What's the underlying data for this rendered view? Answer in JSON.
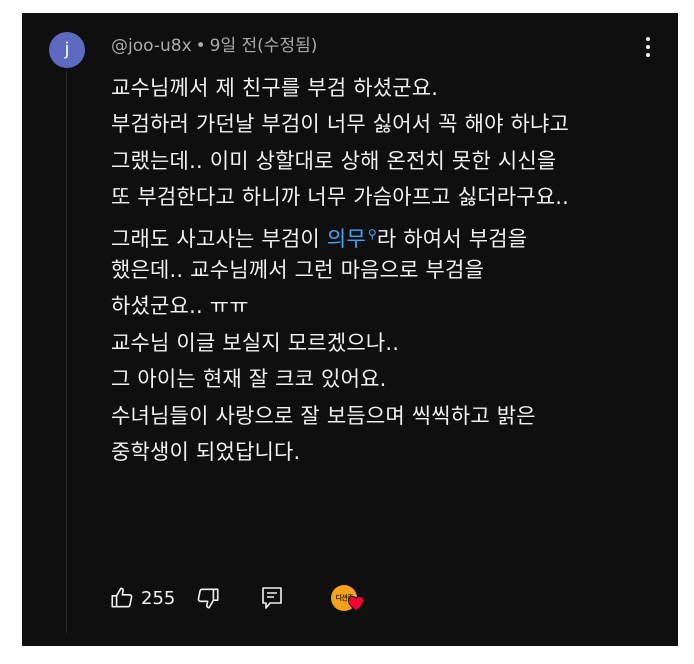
{
  "comment": {
    "avatar_letter": "j",
    "author": "@joo-u8x",
    "separator": "•",
    "timestamp": "9일 전(수정됨)",
    "lines": [
      {
        "text": "교수님께서 제 친구를 부검 하셨군요."
      },
      {
        "text": "부검하러 가던날 부검이 너무 싫어서 꼭 해야 하냐고"
      },
      {
        "text": "그랬는데.. 이미 상할대로 상해 온전치 못한 시신을"
      },
      {
        "text": "또 부검한다고 하니까 너무 가슴아프고 싫더라구요.."
      },
      {
        "pre": "그래도 사고사는 부검이 ",
        "hashtag": "의무",
        "post": "라 하여서 부검을"
      },
      {
        "text": "했은데.. 교수님께서 그런 마음으로 부검을"
      },
      {
        "text": "하셨군요.. ㅠㅠ"
      },
      {
        "text": "교수님 이글 보실지 모르겠으나.."
      },
      {
        "text": "그 아이는 현재 잘 크코 있어요."
      },
      {
        "text": "수녀님들이 사랑으로 잘 보듬으며 씩씩하고 밝은"
      },
      {
        "text": "중학생이 되었답니다."
      }
    ]
  },
  "actions": {
    "like_count": "255",
    "creator_badge_text": "디션죽",
    "icons": [
      "thumbs-up-icon",
      "thumbs-down-icon",
      "reply-icon",
      "creator-heart-icon",
      "more-vert-icon"
    ]
  },
  "colors": {
    "background": "#0f0f0f",
    "text": "#f1f1f1",
    "meta_text": "#aaaaaa",
    "avatar": "#5c6bc0",
    "hashtag": "#3ea6ff",
    "heart": "#ff0033",
    "creator_avatar": "#f4a21c"
  }
}
